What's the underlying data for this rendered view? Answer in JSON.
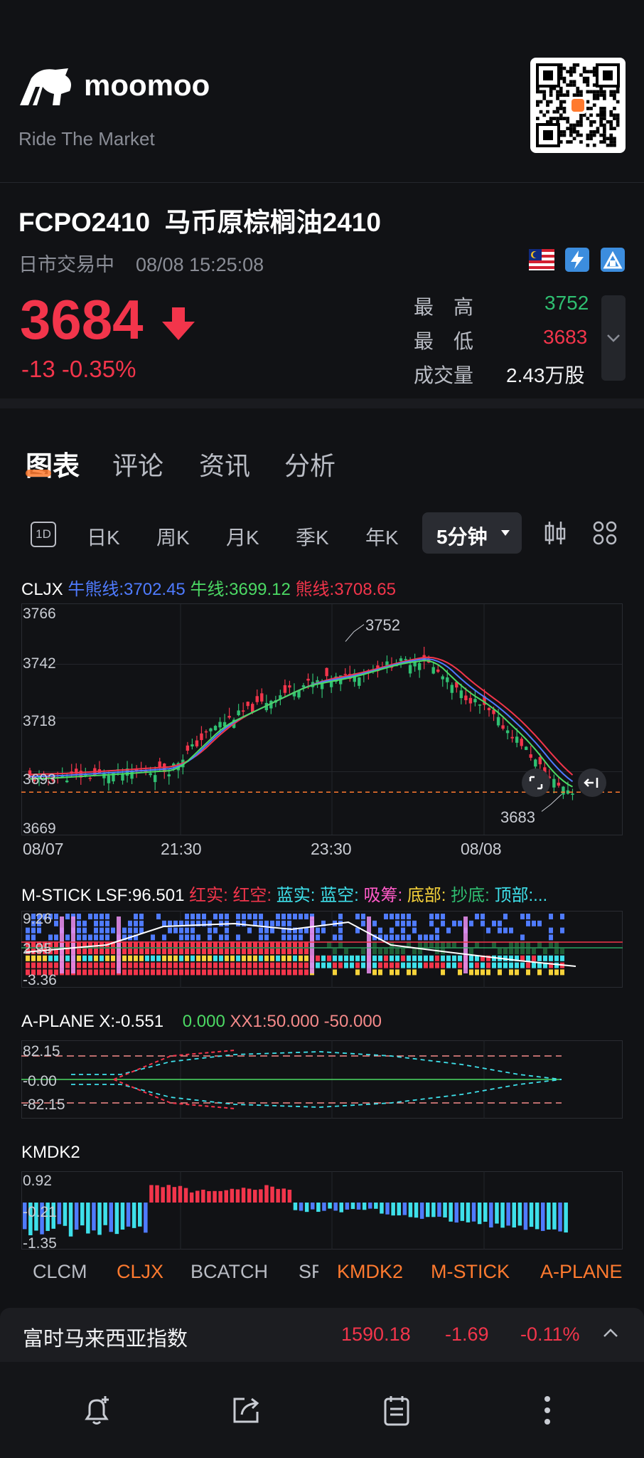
{
  "brand": {
    "name": "moomoo",
    "tagline": "Ride The Market"
  },
  "instrument": {
    "code": "FCPO2410",
    "name": "马币原棕榈油2410",
    "session": "日市交易中",
    "datetime": "08/08 15:25:08",
    "price": "3684",
    "change": "-13",
    "change_pct": "-0.35%",
    "high_label": "最　高",
    "high": "3752",
    "low_label": "最　低",
    "low": "3683",
    "volume_label": "成交量",
    "volume": "2.43万股"
  },
  "tabs": [
    "图表",
    "评论",
    "资讯",
    "分析"
  ],
  "periods": {
    "day1": "1D",
    "items": [
      "日K",
      "周K",
      "月K",
      "季K",
      "年K"
    ],
    "active": "5分钟"
  },
  "main_chart": {
    "legend": {
      "name": "CLJX",
      "l1": "牛熊线:3702.45",
      "l2": "牛线:3699.12",
      "l3": "熊线:3708.65"
    },
    "y_ticks": [
      "3766",
      "3742",
      "3718",
      "3693",
      "3669"
    ],
    "x_ticks": [
      "08/07",
      "21:30",
      "23:30",
      "08/08"
    ],
    "high_label": "3752",
    "low_label": "3683"
  },
  "chart_data": {
    "type": "candlestick",
    "ylim": [
      3669,
      3766
    ],
    "x_ticks": [
      "08/07",
      "21:30",
      "23:30",
      "08/08"
    ],
    "y_ticks": [
      3766,
      3742,
      3718,
      3693,
      3669
    ],
    "high": 3752,
    "low": 3683,
    "last": 3684,
    "series": [
      {
        "name": "牛熊线",
        "last": 3702.45
      },
      {
        "name": "牛线",
        "last": 3699.12
      },
      {
        "name": "熊线",
        "last": 3708.65
      }
    ]
  },
  "mstick": {
    "title": "M-STICK LSF:96.501",
    "labels": [
      "红实:",
      "红空:",
      "蓝实:",
      "蓝空:",
      "吸筹:",
      "底部:",
      "抄底:",
      "顶部:..."
    ],
    "y_ticks": [
      "9.26",
      "2.95",
      "-3.36"
    ]
  },
  "aplane": {
    "title": "A-PLANE X:-0.551",
    "v1": "0.000",
    "v2": "XX1:50.000 -50.000",
    "y_ticks": [
      "82.15",
      "-0.00",
      "-82.15"
    ]
  },
  "kmdk": {
    "title": "KMDK2",
    "y_ticks": [
      "0.92",
      "-0.21",
      "-1.35"
    ]
  },
  "indicators": [
    "CLCM",
    "CLJX",
    "BCATCH",
    "SF",
    "KMDK2",
    "M-STICK",
    "A-PLANE"
  ],
  "index_bar": {
    "name": "富时马来西亚指数",
    "value": "1590.18",
    "change": "-1.69",
    "pct": "-0.11%"
  },
  "colors": {
    "up": "#2fbf71",
    "down": "#f2354b",
    "accent": "#ff7a2f",
    "blue": "#4f7bff",
    "cyan": "#3ee0ea"
  }
}
